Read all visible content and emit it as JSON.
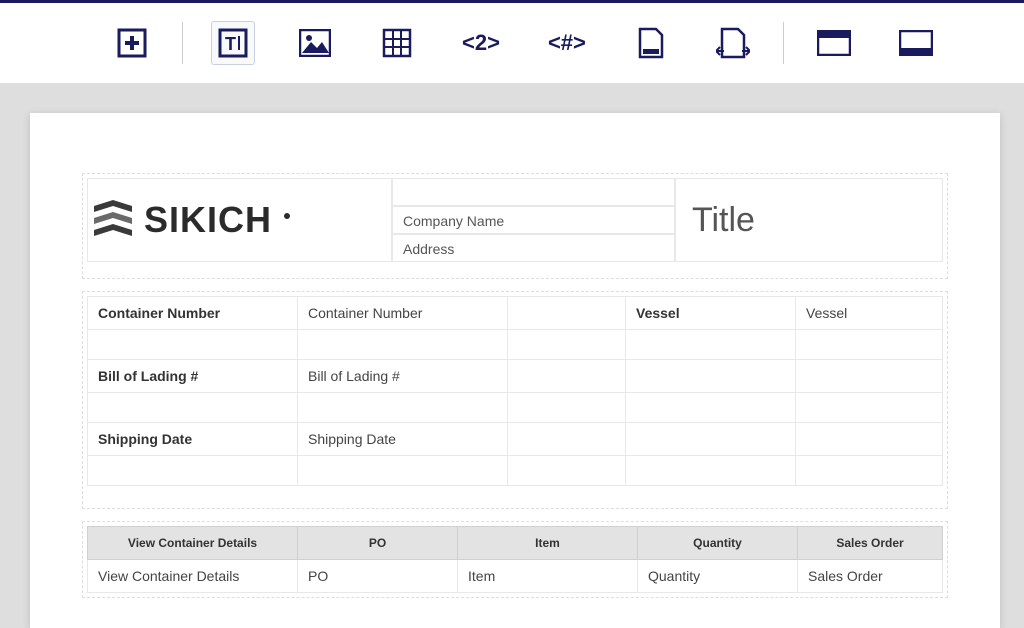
{
  "toolbar": {
    "items": [
      {
        "name": "add-icon"
      },
      {
        "name": "text-icon"
      },
      {
        "name": "image-icon"
      },
      {
        "name": "table-icon"
      },
      {
        "name": "header2-icon",
        "label": "<2>"
      },
      {
        "name": "counter-icon",
        "label": "<#>"
      },
      {
        "name": "page-break-icon"
      },
      {
        "name": "margins-icon"
      },
      {
        "name": "window-header-icon"
      },
      {
        "name": "window-footer-icon"
      }
    ]
  },
  "doc": {
    "logo_text": "SIKICH",
    "company_name": "Company Name",
    "address": "Address",
    "title": "Title"
  },
  "form": {
    "rows": [
      {
        "label1": "Container Number",
        "value1": "Container Number",
        "label2": "Vessel",
        "value2": "Vessel"
      },
      {
        "label1": "",
        "value1": "",
        "label2": "",
        "value2": ""
      },
      {
        "label1": "Bill of Lading #",
        "value1": "Bill of Lading #",
        "label2": "",
        "value2": ""
      },
      {
        "label1": "",
        "value1": "",
        "label2": "",
        "value2": ""
      },
      {
        "label1": "Shipping Date",
        "value1": "Shipping Date",
        "label2": "",
        "value2": ""
      },
      {
        "label1": "",
        "value1": "",
        "label2": "",
        "value2": ""
      }
    ]
  },
  "detail": {
    "headers": [
      "View Container Details",
      "PO",
      "Item",
      "Quantity",
      "Sales Order"
    ],
    "row": [
      "View Container Details",
      "PO",
      "Item",
      "Quantity",
      "Sales Order"
    ]
  }
}
